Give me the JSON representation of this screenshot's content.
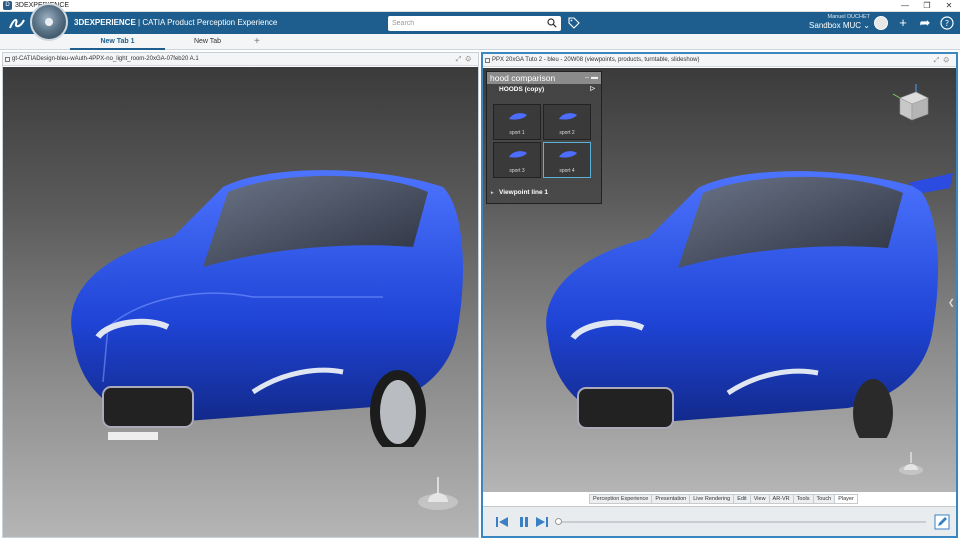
{
  "window": {
    "title": "3DEXPERIENCE",
    "controls": [
      "—",
      "❐",
      "✕"
    ]
  },
  "header": {
    "brand_bold": "3DEXPERIENCE",
    "brand_sep": " | ",
    "brand_app": "CATIA",
    "brand_rest": " Product Perception Experience",
    "search_placeholder": "Search",
    "user_name": "Manuel DUCHET",
    "collab_space": "Sandbox MUC",
    "icons": [
      "search-icon",
      "tag-icon",
      "add-icon",
      "share-icon",
      "help-icon"
    ]
  },
  "tabs": [
    {
      "label": "New Tab 1",
      "active": true
    },
    {
      "label": "New Tab",
      "active": false
    }
  ],
  "tab_add": "+",
  "left_panel": {
    "title": "gt-CATIADesign-bleu-wAuth-4PPX-no_light_room-20xGA-07feb20 A.1"
  },
  "right_panel": {
    "title": "PPX 20xGA Tuto 2 - bleu - 20W08 (viewpoints, products, turntable, slideshow)",
    "widget": {
      "title": "hood comparison",
      "group": "HOODS (copy)",
      "thumbnails": [
        {
          "label": "sport 1",
          "selected": false
        },
        {
          "label": "sport 2",
          "selected": false
        },
        {
          "label": "sport 3",
          "selected": false
        },
        {
          "label": "sport 4",
          "selected": true
        }
      ],
      "viewpoint_line": "Viewpoint line 1"
    },
    "bottom_tabs": [
      {
        "label": "Perception Experience",
        "active": false
      },
      {
        "label": "Presentation",
        "active": false
      },
      {
        "label": "Live Rendering",
        "active": false
      },
      {
        "label": "Edit",
        "active": false
      },
      {
        "label": "View",
        "active": false
      },
      {
        "label": "AR-VR",
        "active": false
      },
      {
        "label": "Tools",
        "active": false
      },
      {
        "label": "Touch",
        "active": false
      },
      {
        "label": "Player",
        "active": true
      }
    ]
  },
  "colors": {
    "header_bg": "#1d5e8e",
    "car_blue": "#2a4fe0",
    "selection": "#3a87c0"
  }
}
